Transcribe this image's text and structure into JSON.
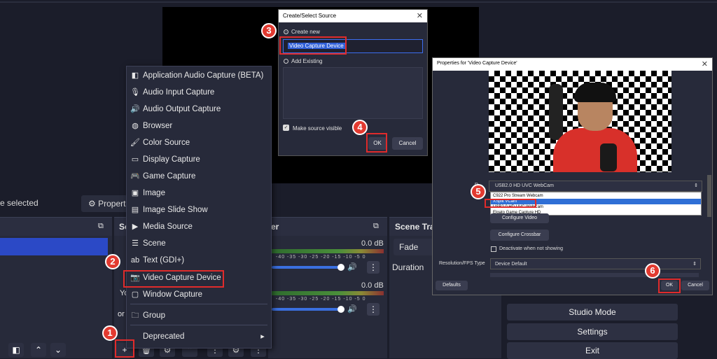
{
  "app": {
    "no_source_selected": "e selected",
    "properties_button": "Properti",
    "scenes_header": "",
    "sources_header": "Sc",
    "mixer_header": "er",
    "transitions_header": "Scene Tra",
    "transition_value": "Fade",
    "duration_label": "Duration",
    "mixer_tracks": [
      {
        "db": "0.0 dB"
      },
      {
        "db": "0.0 dB"
      }
    ],
    "meter_ticks": "-40 -35 -30 -25 -20 -15 -10 -5 0",
    "sources_partial": [
      "Yo",
      "or"
    ],
    "controls": [
      "Studio Mode",
      "Settings",
      "Exit"
    ]
  },
  "context_menu": {
    "items": [
      {
        "label": "Application Audio Capture (BETA)",
        "icon": "app-audio-icon",
        "glyph": "◧"
      },
      {
        "label": "Audio Input Capture",
        "icon": "microphone-icon",
        "glyph": "🎙"
      },
      {
        "label": "Audio Output Capture",
        "icon": "speaker-icon",
        "glyph": "🔊"
      },
      {
        "label": "Browser",
        "icon": "globe-icon",
        "glyph": "◍"
      },
      {
        "label": "Color Source",
        "icon": "brush-icon",
        "glyph": "🖌"
      },
      {
        "label": "Display Capture",
        "icon": "monitor-icon",
        "glyph": "▭"
      },
      {
        "label": "Game Capture",
        "icon": "gamepad-icon",
        "glyph": "🎮"
      },
      {
        "label": "Image",
        "icon": "image-icon",
        "glyph": "▣"
      },
      {
        "label": "Image Slide Show",
        "icon": "slideshow-icon",
        "glyph": "▤"
      },
      {
        "label": "Media Source",
        "icon": "play-icon",
        "glyph": "▶"
      },
      {
        "label": "Scene",
        "icon": "list-icon",
        "glyph": "☰"
      },
      {
        "label": "Text (GDI+)",
        "icon": "text-icon",
        "glyph": "ab"
      },
      {
        "label": "Video Capture Device",
        "icon": "camera-icon",
        "glyph": "📷"
      },
      {
        "label": "Window Capture",
        "icon": "window-icon",
        "glyph": "▢"
      },
      {
        "label": "Group",
        "icon": "folder-icon",
        "glyph": "🗀"
      },
      {
        "label": "Deprecated",
        "icon": "submenu-arrow-icon",
        "glyph": "▸"
      }
    ]
  },
  "create_dialog": {
    "title": "Create/Select Source",
    "create_new": "Create new",
    "name_value": "Video Capture Device",
    "add_existing": "Add Existing",
    "make_visible": "Make source visible",
    "ok": "OK",
    "cancel": "Cancel"
  },
  "properties_dialog": {
    "title": "Properties for 'Video Capture Device'",
    "device_label": "D",
    "device_value": "USB2.0 HD UVC WebCam",
    "device_options": [
      "C922 Pro Stream Webcam",
      "XSplit VCam",
      "USB2.0 HD UVC WebCam",
      "Elgato Game Capture HD"
    ],
    "configure_video": "Configure Video",
    "configure_crossbar": "Configure Crossbar",
    "deactivate": "Deactivate when not showing",
    "resolution_label": "Resolution/FPS Type",
    "resolution_value": "Device Default",
    "defaults": "Defaults",
    "ok": "OK",
    "cancel": "Cancel"
  },
  "steps": [
    "1",
    "2",
    "3",
    "4",
    "5",
    "6"
  ],
  "colors": {
    "highlight": "#e02b2b",
    "selection": "#2b49c6",
    "badge": "#e23a30"
  }
}
